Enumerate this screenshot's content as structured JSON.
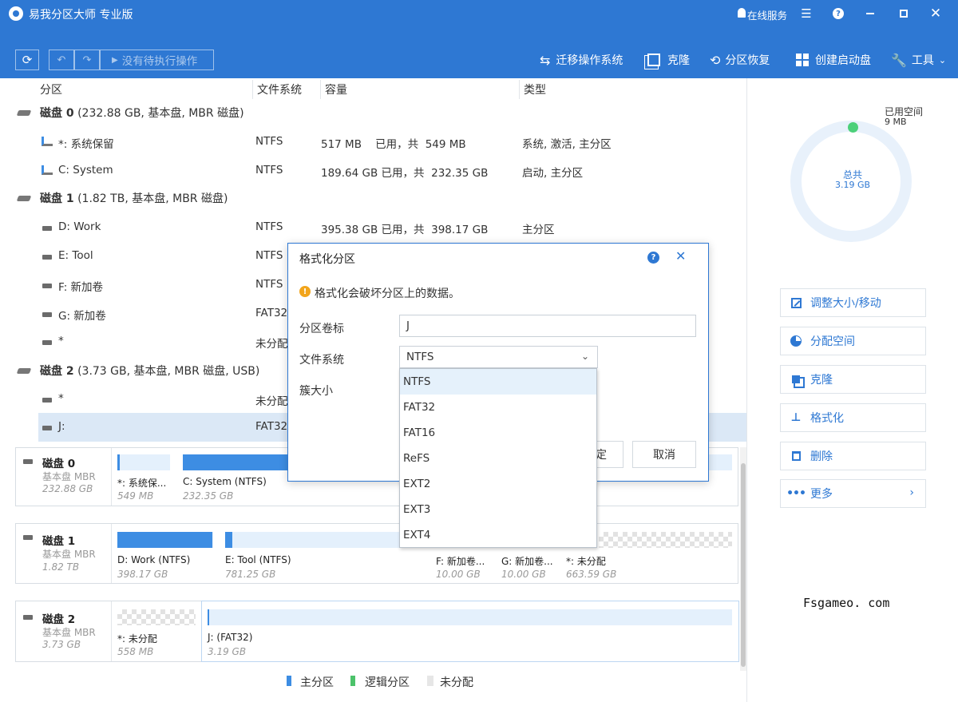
{
  "app": {
    "title": "易我分区大师 专业版",
    "online_service": "在线服务"
  },
  "toolbar": {
    "pending_label": "没有待执行操作",
    "migrate_os": "迁移操作系统",
    "clone": "克隆",
    "partition_recovery": "分区恢复",
    "create_boot": "创建启动盘",
    "tools": "工具"
  },
  "columns": {
    "partition": "分区",
    "filesystem": "文件系统",
    "capacity": "容量",
    "type": "类型"
  },
  "disks": [
    {
      "title": "磁盘 0",
      "detail": "(232.88 GB, 基本盘, MBR 磁盘)"
    },
    {
      "title": "磁盘 1",
      "detail": "(1.82 TB, 基本盘, MBR 磁盘)"
    },
    {
      "title": "磁盘 2",
      "detail": "(3.73 GB, 基本盘, MBR 磁盘, USB)"
    }
  ],
  "rows": [
    {
      "name": "*: 系统保留",
      "fs": "NTFS",
      "cap": "517 MB    已用，共  549 MB",
      "type": "系统, 激活, 主分区"
    },
    {
      "name": "C: System",
      "fs": "NTFS",
      "cap": "189.64 GB 已用，共  232.35 GB",
      "type": "启动, 主分区"
    },
    {
      "name": "D: Work",
      "fs": "NTFS",
      "cap": "395.38 GB 已用，共  398.17 GB",
      "type": "主分区"
    },
    {
      "name": "E: Tool",
      "fs": "NTFS",
      "cap": "",
      "type": ""
    },
    {
      "name": "F: 新加卷",
      "fs": "NTFS",
      "cap": "",
      "type": ""
    },
    {
      "name": "G: 新加卷",
      "fs": "FAT32",
      "cap": "",
      "type": ""
    },
    {
      "name": "*",
      "fs": "未分配",
      "cap": "",
      "type": ""
    },
    {
      "name": "*",
      "fs": "未分配",
      "cap": "",
      "type": ""
    },
    {
      "name": "J:",
      "fs": "FAT32",
      "cap": "",
      "type": ""
    }
  ],
  "map": [
    {
      "name": "磁盘 0",
      "kind": "基本盘 MBR",
      "size": "232.88 GB",
      "parts": [
        {
          "label": "*: 系统保...",
          "size": "549 MB"
        },
        {
          "label": "C: System (NTFS)",
          "size": "232.35 GB"
        }
      ]
    },
    {
      "name": "磁盘 1",
      "kind": "基本盘 MBR",
      "size": "1.82 TB",
      "parts": [
        {
          "label": "D: Work (NTFS)",
          "size": "398.17 GB"
        },
        {
          "label": "E: Tool (NTFS)",
          "size": "781.25 GB"
        },
        {
          "label": "F: 新加卷...",
          "size": "10.00 GB"
        },
        {
          "label": "G: 新加卷...",
          "size": "10.00 GB"
        },
        {
          "label": "*: 未分配",
          "size": "663.59 GB"
        }
      ]
    },
    {
      "name": "磁盘 2",
      "kind": "基本盘 MBR",
      "size": "3.73 GB",
      "parts": [
        {
          "label": "*: 未分配",
          "size": "558 MB"
        },
        {
          "label": "J:  (FAT32)",
          "size": "3.19 GB"
        }
      ]
    }
  ],
  "legend": {
    "primary": "主分区",
    "logical": "逻辑分区",
    "unallocated": "未分配"
  },
  "usage": {
    "used_label": "已用空间",
    "used_value": "9 MB",
    "total_label": "总共",
    "total_value": "3.19 GB",
    "used_fraction": 0.003
  },
  "actions": [
    "调整大小/移动",
    "分配空间",
    "克隆",
    "格式化",
    "删除",
    "更多"
  ],
  "watermark": "Fsgameo. com",
  "dialog": {
    "title": "格式化分区",
    "warning": "格式化会破坏分区上的数据。",
    "label_volume": "分区卷标",
    "volume_value": "J",
    "label_fs": "文件系统",
    "fs_value": "NTFS",
    "label_cluster": "簇大小",
    "ok_partial": "定",
    "cancel": "取消",
    "fs_options": [
      "NTFS",
      "FAT32",
      "FAT16",
      "ReFS",
      "EXT2",
      "EXT3",
      "EXT4"
    ]
  },
  "colors": {
    "accent": "#2e78d3",
    "primary_part": "#3d8de3",
    "logical_part": "#4cc26a",
    "unallocated": "#e6e6e6"
  }
}
